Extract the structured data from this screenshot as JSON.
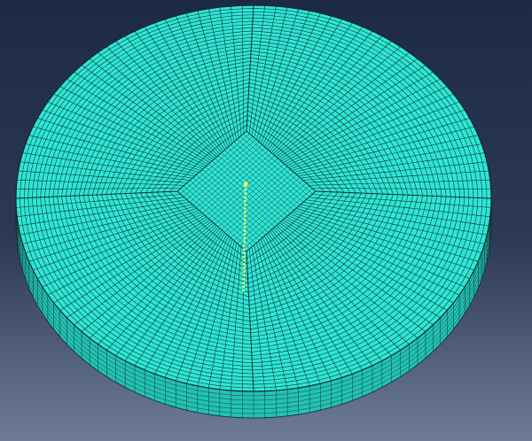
{
  "viewport": {
    "background_top": "#1c2a45",
    "background_bottom": "#6f7c96"
  },
  "mesh": {
    "fill": "#2ee6d6",
    "side_fill": "#22c2b4",
    "line_color": "#0f2a2a",
    "rings": 34,
    "spokes": 132,
    "core_grid": 22,
    "side_layers": 6
  },
  "crack_front": {
    "color": "#f4ff5a"
  }
}
